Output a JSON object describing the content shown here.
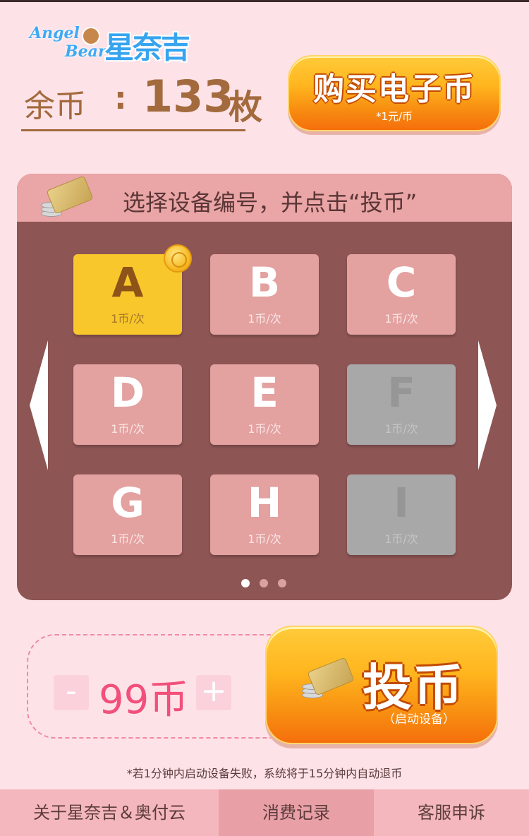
{
  "logo": {
    "en_top": "Angel",
    "en_bottom": "Bear",
    "cn": "星奈吉"
  },
  "balance": {
    "label": "余币",
    "colon": ":",
    "value": "133",
    "unit": "枚"
  },
  "buy_button": {
    "label": "购买电子币",
    "sub": "*1元/币"
  },
  "panel": {
    "title": "选择设备编号，并点击“投币”",
    "tiles": [
      {
        "letter": "A",
        "price": "1币/次",
        "state": "selected"
      },
      {
        "letter": "B",
        "price": "1币/次",
        "state": "available"
      },
      {
        "letter": "C",
        "price": "1币/次",
        "state": "available"
      },
      {
        "letter": "D",
        "price": "1币/次",
        "state": "available"
      },
      {
        "letter": "E",
        "price": "1币/次",
        "state": "available"
      },
      {
        "letter": "F",
        "price": "1币/次",
        "state": "disabled"
      },
      {
        "letter": "G",
        "price": "1币/次",
        "state": "available"
      },
      {
        "letter": "H",
        "price": "1币/次",
        "state": "available"
      },
      {
        "letter": "I",
        "price": "1币/次",
        "state": "disabled"
      }
    ],
    "pages": {
      "count": 3,
      "active": 1
    }
  },
  "amount": {
    "minus": "-",
    "value": "99币",
    "plus": "+"
  },
  "insert_button": {
    "label": "投币",
    "sub": "（启动设备）"
  },
  "notice": "*若1分钟内启动设备失败，系统将于15分钟内自动退币",
  "footer": [
    {
      "label": "关于星奈吉＆奥付云",
      "active": false
    },
    {
      "label": "消费记录",
      "active": true
    },
    {
      "label": "客服申诉",
      "active": false
    }
  ],
  "colors": {
    "accent": "#f24f7b",
    "panel_bg": "#8d5554",
    "tile": "#e3a1a0",
    "tile_selected": "#f8c72b",
    "tile_disabled": "#a8a8a8"
  }
}
